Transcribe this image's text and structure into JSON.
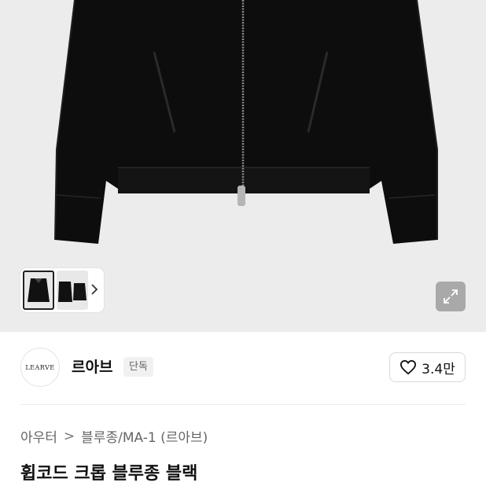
{
  "gallery": {
    "main_image": "product-photo-black-blouson",
    "thumbnails": [
      "jacket-front-thumbnail",
      "jacket-pair-thumbnail"
    ],
    "next_icon": "chevron-right-icon",
    "expand_icon": "expand-arrows-icon",
    "background_color": "#ececec"
  },
  "brand": {
    "logo_text": "LEARVE",
    "name": "르아브",
    "badge": "단독"
  },
  "like": {
    "icon": "heart-outline-icon",
    "count": "3.4만"
  },
  "breadcrumb": {
    "category": "아우터",
    "separator": ">",
    "subcategory": "블루종/MA-1 (르아브)"
  },
  "product": {
    "title": "휩코드 크롭 블루종 블랙"
  }
}
